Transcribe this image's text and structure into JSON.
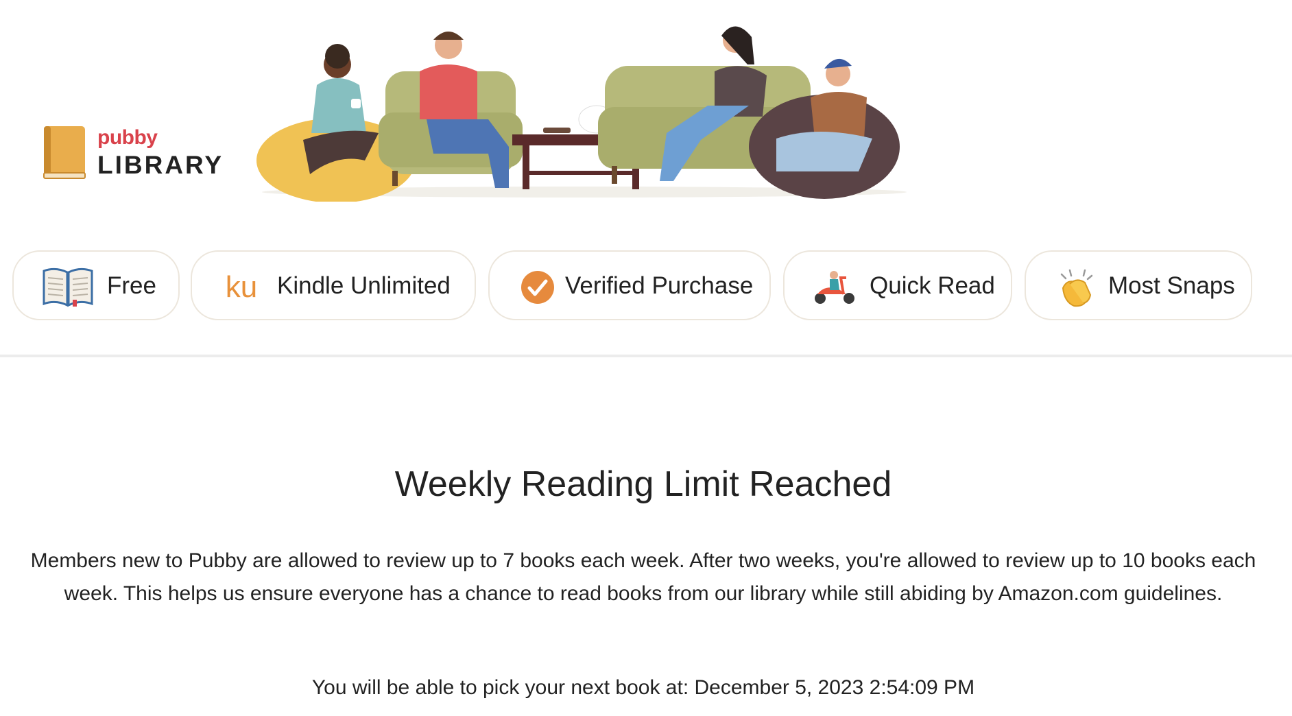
{
  "brand": {
    "top": "pubby",
    "bottom": "LIBRARY",
    "accent": "#d9424b"
  },
  "filters": [
    {
      "label": "Free",
      "icon": "open-book-icon"
    },
    {
      "label": "Kindle Unlimited",
      "icon": "ku-icon",
      "icon_text": "ku"
    },
    {
      "label": "Verified Purchase",
      "icon": "check-circle-icon"
    },
    {
      "label": "Quick Read",
      "icon": "scooter-icon"
    },
    {
      "label": "Most Snaps",
      "icon": "clapping-hands-icon"
    }
  ],
  "notice": {
    "title": "Weekly Reading Limit Reached",
    "body": "Members new to Pubby are allowed to review up to 7 books each week. After two weeks, you're allowed to review up to 10 books each week. This helps us ensure everyone has a chance to read books from our library while still abiding by Amazon.com guidelines.",
    "next_pick": "You will be able to pick your next book at: December 5, 2023 2:54:09 PM"
  },
  "colors": {
    "pill_border": "#ece6dc",
    "ku_orange": "#e8913a",
    "check_orange": "#e68a3d",
    "logo_book": "#e9ad4c"
  }
}
